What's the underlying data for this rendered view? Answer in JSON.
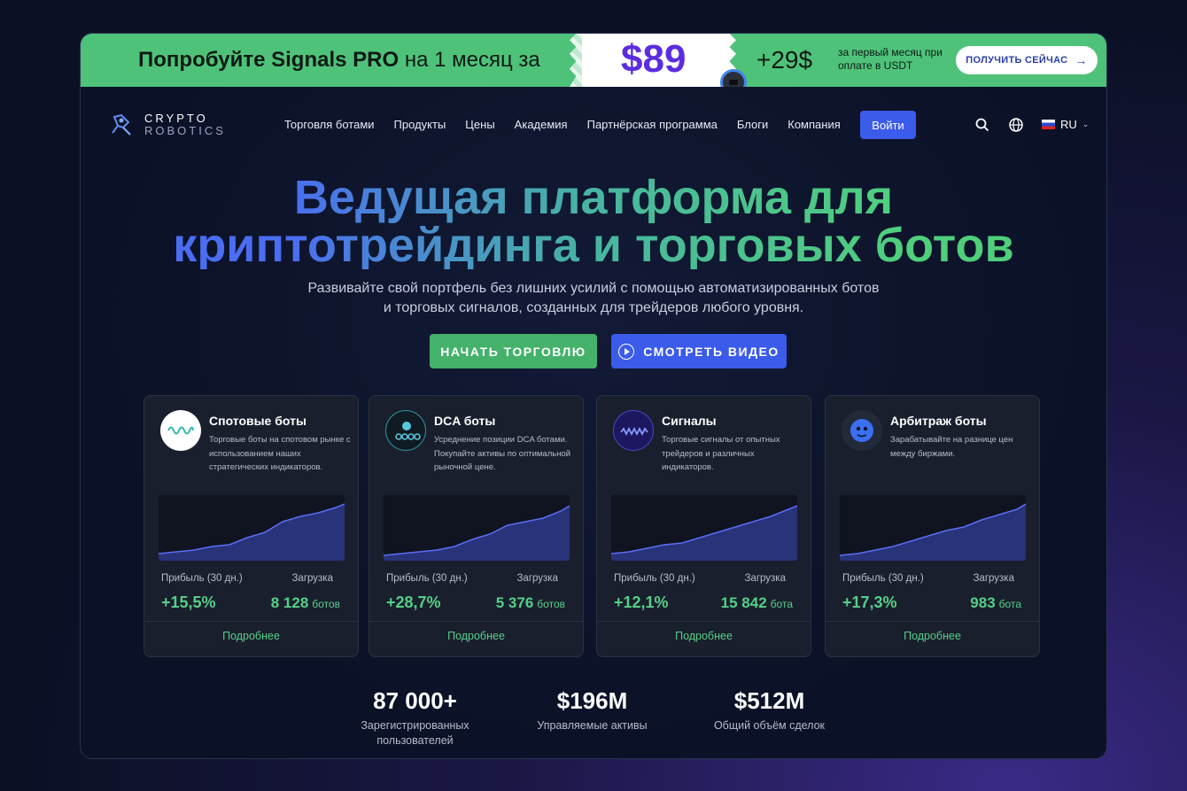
{
  "promo": {
    "text_bold": "Попробуйте Signals PRO",
    "text_light": "на 1 месяц за",
    "price": "$89",
    "old_price": "+29$",
    "note": "за первый месяц при оплате в USDT",
    "button_label": "ПОЛУЧИТЬ СЕЙЧАС",
    "button_icon": "arrow-right-icon"
  },
  "header": {
    "logo_line1": "CRYPTO",
    "logo_line2": "ROBOTICS",
    "nav": [
      "Торговля ботами",
      "Продукты",
      "Цены",
      "Академия",
      "Партнёрская программа",
      "Блоги",
      "Компания"
    ],
    "login_label": "Войти",
    "language": "RU"
  },
  "hero": {
    "title_line1": "Ведущая платформа для",
    "title_line2": "криптотрейдинга и торговых ботов",
    "subtitle_line1": "Развивайте свой портфель без лишних усилий с помощью автоматизированных ботов",
    "subtitle_line2": "и торговых сигналов, созданных для трейдеров любого уровня.",
    "cta_start": "НАЧАТЬ ТОРГОВЛЮ",
    "cta_video": "СМОТРЕТЬ ВИДЕО"
  },
  "cards": [
    {
      "title": "Спотовые боты",
      "desc": "Торговые боты на спотовом рынке с использованием наших стратегических индикаторов.",
      "profit_label": "Прибыль (30 дн.)",
      "load_label": "Загрузка",
      "profit": "+15,5%",
      "load_value": "8 128",
      "load_unit": "ботов",
      "more": "Подробнее"
    },
    {
      "title": "DCA боты",
      "desc": "Усреднение позиции DCA ботами. Покупайте активы по оптимальной рыночной цене.",
      "profit_label": "Прибыль (30 дн.)",
      "load_label": "Загрузка",
      "profit": "+28,7%",
      "load_value": "5 376",
      "load_unit": "ботов",
      "more": "Подробнее"
    },
    {
      "title": "Сигналы",
      "desc": "Торговые сигналы от опытных трейдеров и различных индикаторов.",
      "profit_label": "Прибыль (30 дн.)",
      "load_label": "Загрузка",
      "profit": "+12,1%",
      "load_value": "15 842",
      "load_unit": "бота",
      "more": "Подробнее"
    },
    {
      "title": "Арбитраж боты",
      "desc": "Зарабатывайте на разнице цен между биржами.",
      "profit_label": "Прибыль (30 дн.)",
      "load_label": "Загрузка",
      "profit": "+17,3%",
      "load_value": "983",
      "load_unit": "бота",
      "more": "Подробнее"
    }
  ],
  "stats": [
    {
      "value": "87 000+",
      "label_line1": "Зарегистрированных",
      "label_line2": "пользователей"
    },
    {
      "value": "$196M",
      "label_line1": "Управляемые активы",
      "label_line2": ""
    },
    {
      "value": "$512M",
      "label_line1": "Общий объём сделок",
      "label_line2": ""
    }
  ],
  "colors": {
    "accent_green": "#4fc27a",
    "accent_blue": "#3b5bea",
    "profit_green": "#55d088",
    "price_purple": "#5b2ce0"
  }
}
